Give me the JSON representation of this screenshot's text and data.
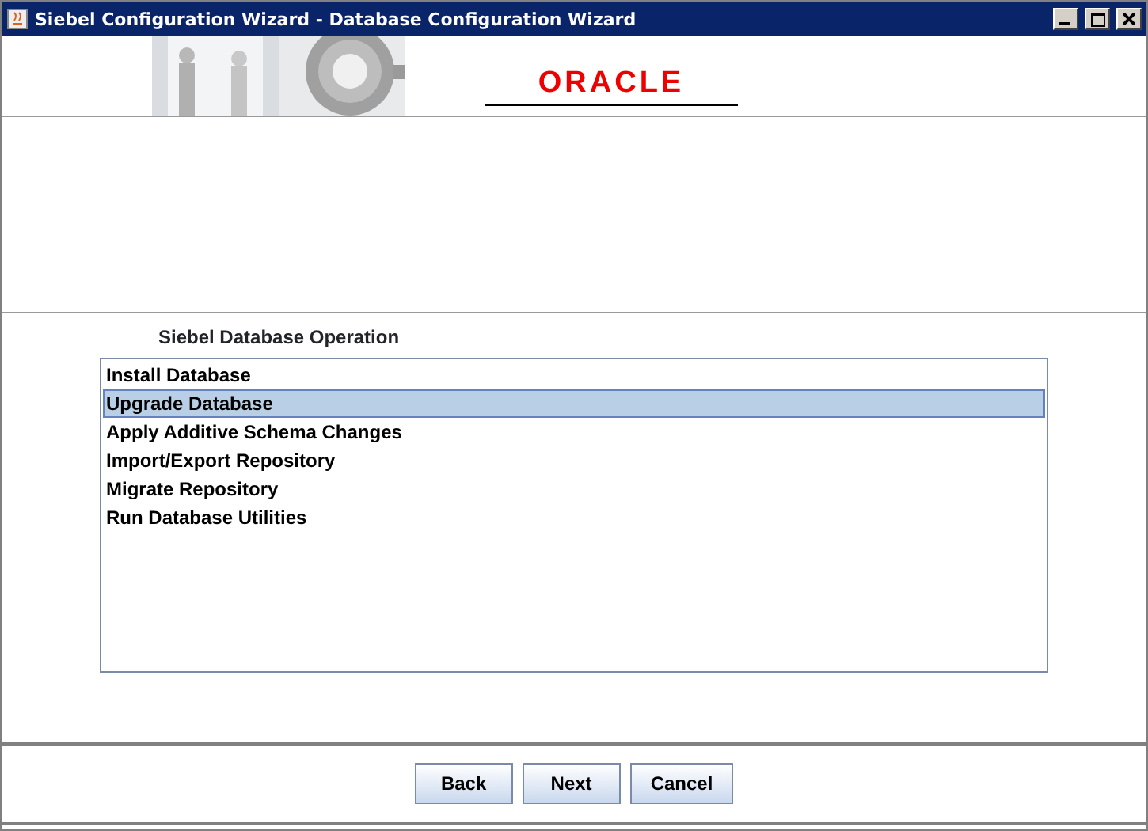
{
  "window": {
    "title": "Siebel Configuration Wizard - Database Configuration Wizard"
  },
  "banner": {
    "logo": "ORACLE"
  },
  "section_label": "Siebel Database Operation",
  "operations": [
    {
      "label": "Install Database",
      "selected": false
    },
    {
      "label": "Upgrade Database",
      "selected": true
    },
    {
      "label": "Apply Additive Schema Changes",
      "selected": false
    },
    {
      "label": "Import/Export Repository",
      "selected": false
    },
    {
      "label": "Migrate Repository",
      "selected": false
    },
    {
      "label": "Run Database Utilities",
      "selected": false
    }
  ],
  "buttons": [
    "Back",
    "Next",
    "Cancel"
  ]
}
